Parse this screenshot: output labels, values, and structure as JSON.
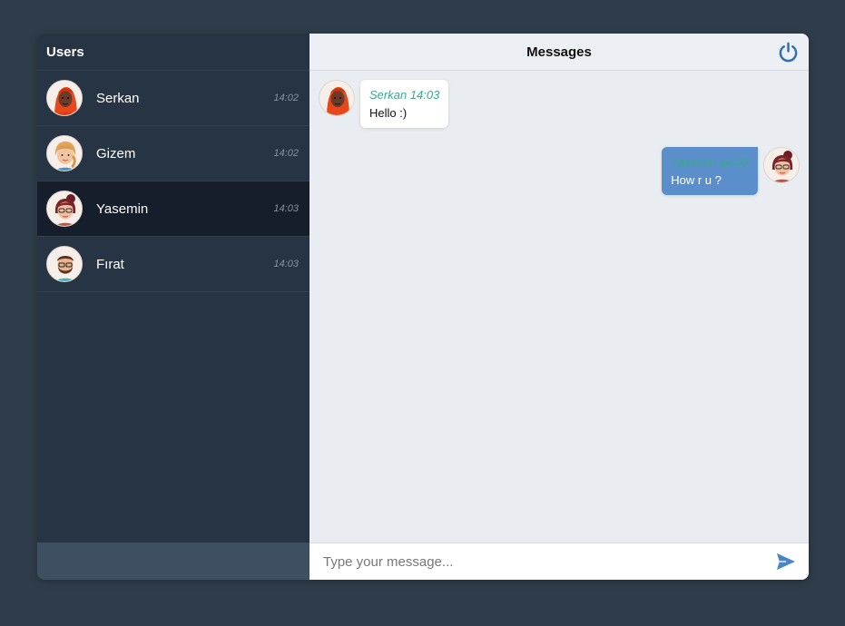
{
  "sidebar": {
    "title": "Users",
    "users": [
      {
        "name": "Serkan",
        "time": "14:02",
        "avatar": "serkan-avatar"
      },
      {
        "name": "Gizem",
        "time": "14:02",
        "avatar": "gizem-avatar"
      },
      {
        "name": "Yasemin",
        "time": "14:03",
        "avatar": "yasemin-avatar",
        "active": true
      },
      {
        "name": "Fırat",
        "time": "14:03",
        "avatar": "firat-avatar"
      }
    ]
  },
  "chat": {
    "title": "Messages",
    "power_icon": "power-icon",
    "messages": [
      {
        "author": "Serkan",
        "time": "14:03",
        "meta": "Serkan 14:03",
        "text": "Hello :)",
        "side": "left"
      },
      {
        "author": "Yasemin",
        "time": "14:03",
        "meta": "Yasemin 14:03",
        "text": "How r u ?",
        "side": "right"
      }
    ],
    "composer": {
      "placeholder": "Type your message...",
      "value": "",
      "send_icon": "send-icon"
    }
  },
  "colors": {
    "background": "#2f3d4a",
    "sidebar": "#273443",
    "sidebar_active": "#151e2a",
    "chat_background": "#e9ecf0",
    "outgoing_bubble": "#5a8fcb",
    "meta_text": "#3ba88e",
    "accent": "#4a86c5"
  }
}
